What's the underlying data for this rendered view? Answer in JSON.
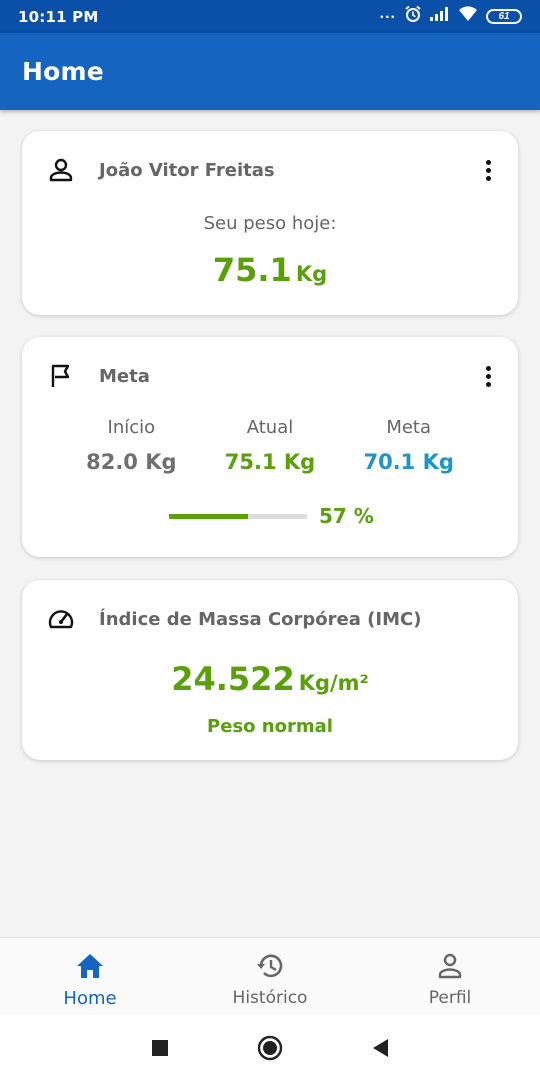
{
  "status_bar": {
    "time": "10:11 PM",
    "dots": "...",
    "battery": "61"
  },
  "app_bar": {
    "title": "Home"
  },
  "user_card": {
    "name": "João Vitor Freitas",
    "weight_label": "Seu peso hoje:",
    "weight_value": "75.1",
    "weight_unit": "Kg"
  },
  "goal_card": {
    "title": "Meta",
    "columns": [
      {
        "label": "Início",
        "value": "82.0 Kg",
        "color": "#6f6f6f"
      },
      {
        "label": "Atual",
        "value": "75.1 Kg",
        "color": "#5a9f0c"
      },
      {
        "label": "Meta",
        "value": "70.1 Kg",
        "color": "#1e95c8"
      }
    ],
    "progress_fraction": 0.57,
    "progress_text": "57 %"
  },
  "imc_card": {
    "title": "Índice de Massa Corpórea (IMC)",
    "value": "24.522",
    "unit": "Kg/m²",
    "status": "Peso normal"
  },
  "bottom_nav": {
    "items": [
      {
        "label": "Home",
        "icon": "home-icon",
        "active": true
      },
      {
        "label": "Histórico",
        "icon": "history-icon",
        "active": false
      },
      {
        "label": "Perfil",
        "icon": "person-icon",
        "active": false
      }
    ]
  },
  "colors": {
    "primary": "#1565c0",
    "status_bar": "#0a4fa8",
    "green": "#5a9f0c",
    "blue_value": "#1e95c8"
  }
}
